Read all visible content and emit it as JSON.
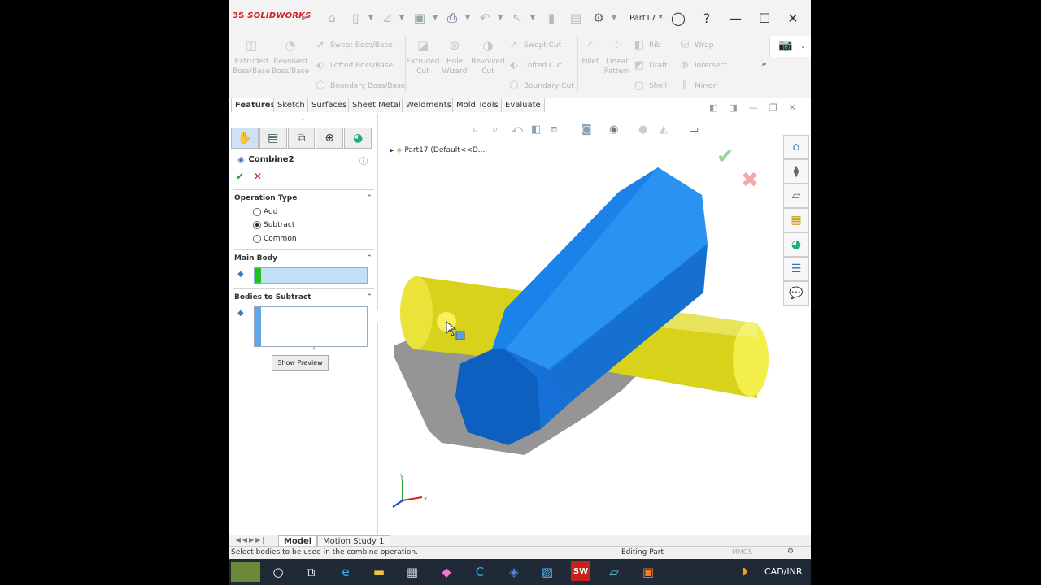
{
  "app": {
    "brand": "SOLIDWORKS",
    "brand_prefix": "3S",
    "document_title": "Part17 *"
  },
  "toolbar_icons": [
    "home-icon",
    "new-icon",
    "open-icon",
    "save-icon",
    "print-icon",
    "undo-icon",
    "select-icon",
    "rebuild-icon",
    "file-props-icon",
    "options-icon"
  ],
  "command_manager": {
    "extruded_boss": "Extruded\nBoss/Base",
    "revolved_boss": "Revolved\nBoss/Base",
    "swept_boss": "Swept Boss/Base",
    "lofted_boss": "Lofted Boss/Base",
    "boundary_boss": "Boundary Boss/Base",
    "extruded_cut": "Extruded\nCut",
    "hole_wizard": "Hole\nWizard",
    "revolved_cut": "Revolved\nCut",
    "swept_cut": "Swept Cut",
    "lofted_cut": "Lofted Cut",
    "boundary_cut": "Boundary Cut",
    "fillet": "Fillet",
    "linear_pattern": "Linear\nPattern",
    "rib": "Rib",
    "draft": "Draft",
    "shell": "Shell",
    "wrap": "Wrap",
    "intersect": "Intersect",
    "mirror": "Mirror",
    "more": "»"
  },
  "tabs": [
    "Features",
    "Sketch",
    "Surfaces",
    "Sheet Metal",
    "Weldments",
    "Mold Tools",
    "Evaluate"
  ],
  "property_manager": {
    "title": "Combine2",
    "operation_type": {
      "title": "Operation Type",
      "options": [
        "Add",
        "Subtract",
        "Common"
      ],
      "selected": "Subtract"
    },
    "main_body": {
      "title": "Main Body"
    },
    "bodies_to_subtract": {
      "title": "Bodies to Subtract"
    },
    "show_preview": "Show Preview"
  },
  "graphics": {
    "tree_label": "Part17  (Default<<D...",
    "triad": {
      "x": "x",
      "y": "y"
    },
    "colors": {
      "yellow_body": "#e6e01a",
      "blue_body": "#1a78e0",
      "ok": "#8fd38f",
      "cancel": "#f0a0a0"
    }
  },
  "bottom_tabs": [
    "Model",
    "Motion Study 1"
  ],
  "status": {
    "message": "Select bodies to be used in the combine operation.",
    "mode": "Editing Part",
    "units": "MMGS"
  },
  "taskbar": {
    "tray_label": "CAD/INR"
  }
}
